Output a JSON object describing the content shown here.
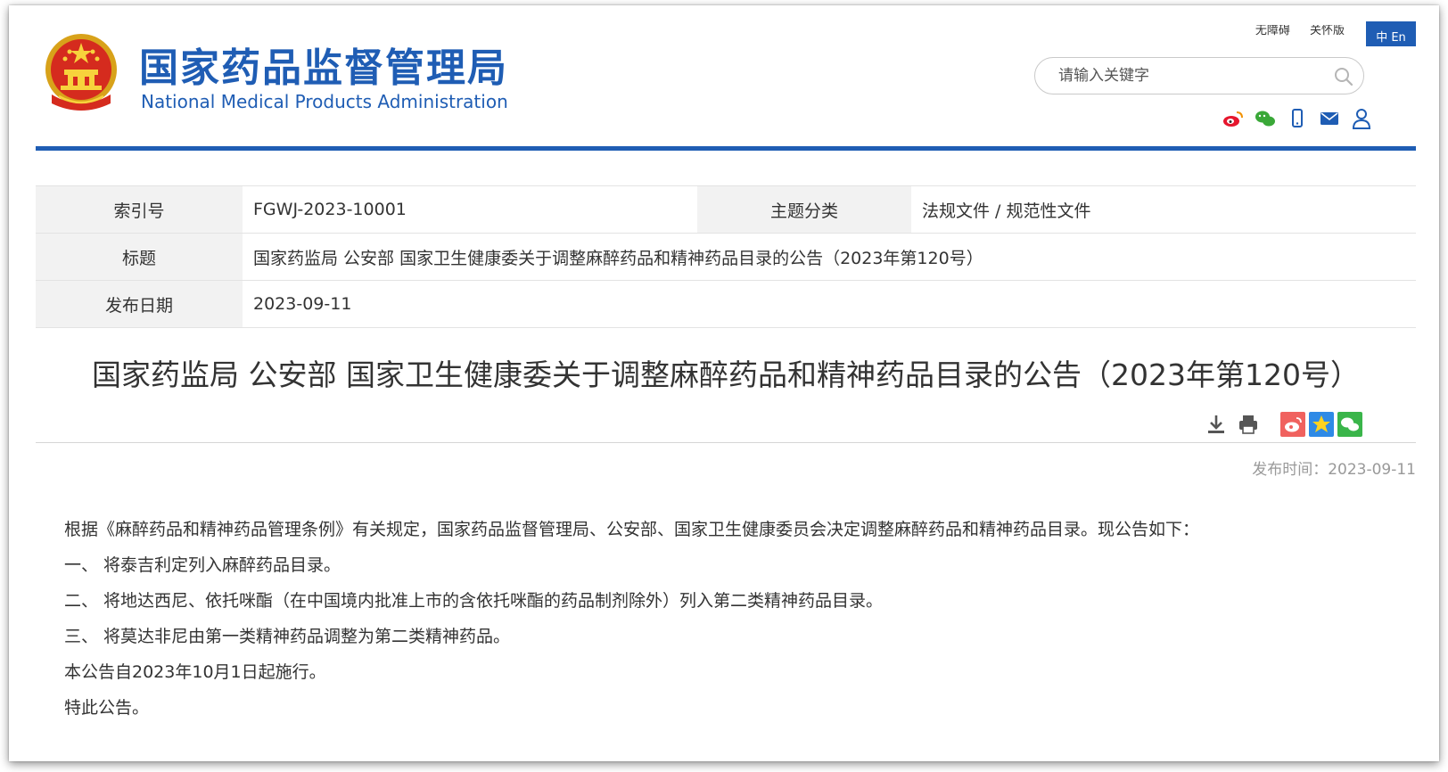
{
  "header": {
    "site_title": "国家药品监督管理局",
    "site_subtitle": "National Medical Products Administration",
    "top_links": [
      "无障碍",
      "关怀版"
    ],
    "lang_label": "中 En",
    "search_placeholder": "请输入关键字",
    "social_icons": [
      "weibo-icon",
      "wechat-icon",
      "mobile-icon",
      "mail-icon",
      "user-icon"
    ],
    "brand_color": "#1f5db4"
  },
  "meta": {
    "index_label": "索引号",
    "index_value": "FGWJ-2023-10001",
    "category_label": "主题分类",
    "category_value": "法规文件 / 规范性文件",
    "title_label": "标题",
    "title_value": "国家药监局 公安部 国家卫生健康委关于调整麻醉药品和精神药品目录的公告（2023年第120号）",
    "date_label": "发布日期",
    "date_value": "2023-09-11"
  },
  "article": {
    "title": "国家药监局 公安部 国家卫生健康委关于调整麻醉药品和精神药品目录的公告（2023年第120号）",
    "publish_time": "发布时间：2023-09-11",
    "paragraphs": [
      "根据《麻醉药品和精神药品管理条例》有关规定，国家药品监督管理局、公安部、国家卫生健康委员会决定调整麻醉药品和精神药品目录。现公告如下：",
      "一、 将泰吉利定列入麻醉药品目录。",
      "二、 将地达西尼、依托咪酯（在中国境内批准上市的含依托咪酯的药品制剂除外）列入第二类精神药品目录。",
      "三、 将莫达非尼由第一类精神药品调整为第二类精神药品。",
      "本公告自2023年10月1日起施行。",
      "特此公告。"
    ],
    "tool_icons": [
      "download-icon",
      "print-icon",
      "weibo-share-icon",
      "favorite-icon",
      "wechat-share-icon"
    ]
  }
}
